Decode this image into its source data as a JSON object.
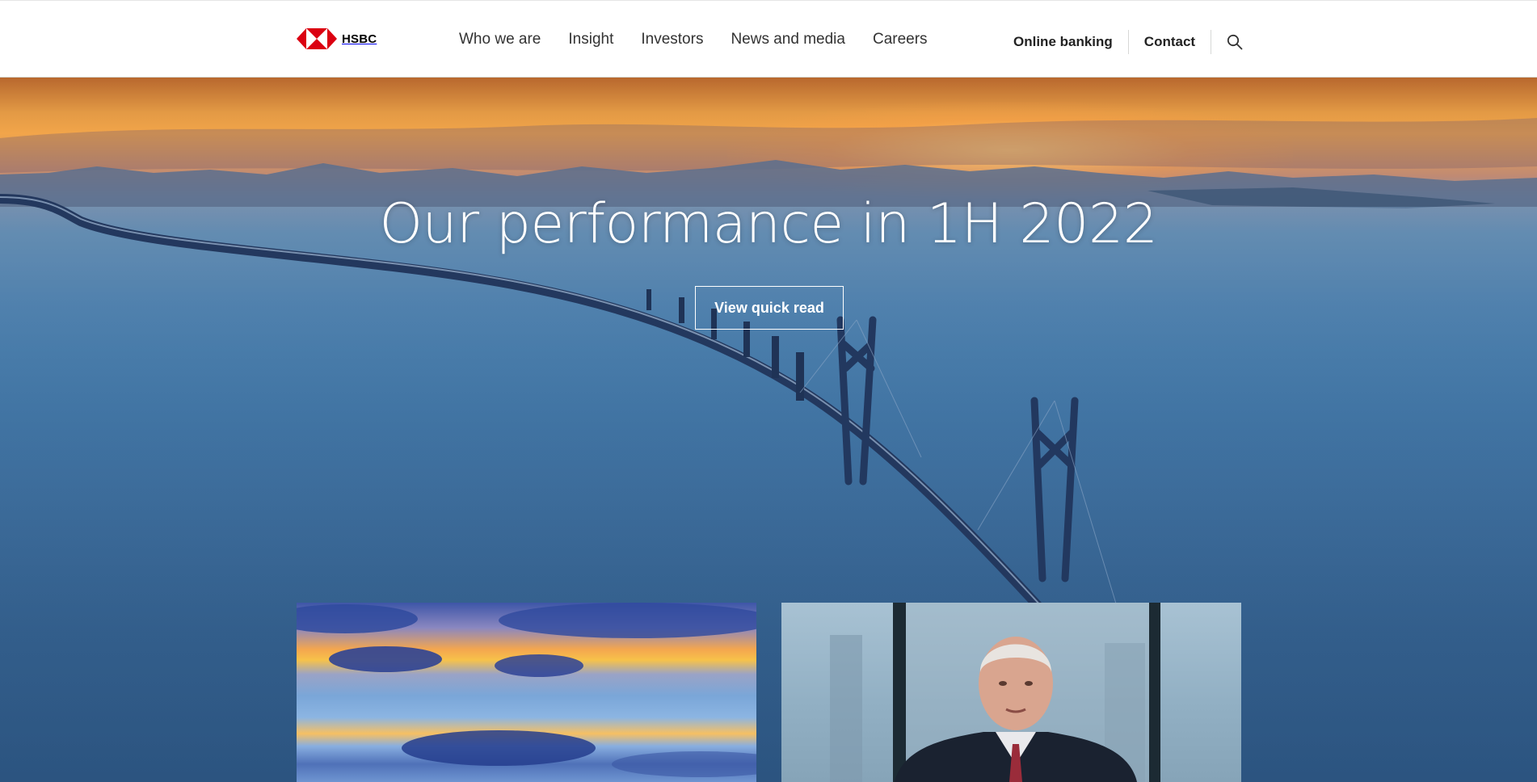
{
  "brand": {
    "name": "HSBC",
    "hexagon_color": "#db0011"
  },
  "nav": {
    "items": [
      {
        "label": "Who we are"
      },
      {
        "label": "Insight"
      },
      {
        "label": "Investors"
      },
      {
        "label": "News and media"
      },
      {
        "label": "Careers"
      }
    ]
  },
  "utility": {
    "online_banking": "Online banking",
    "contact": "Contact",
    "search_icon": "search-icon"
  },
  "hero": {
    "title": "Our performance in 1H 2022",
    "cta_label": "View quick read"
  },
  "cards": [
    {
      "image": "sunset-clouds-sky"
    },
    {
      "image": "executive-portrait-video-still"
    }
  ]
}
